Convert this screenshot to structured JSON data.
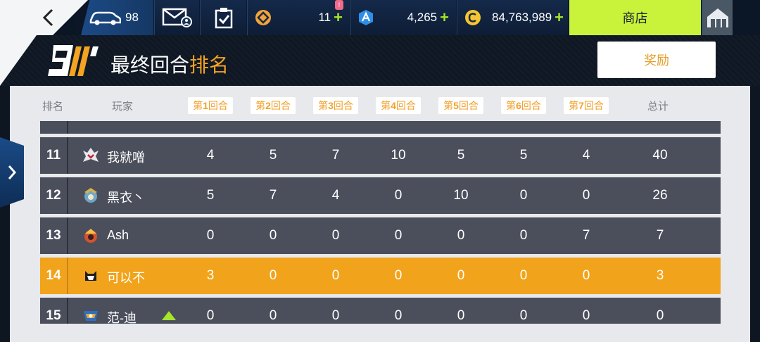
{
  "topbar": {
    "car_count": "98",
    "coin_diamond_value": "11",
    "coin_diamond_plus": "+",
    "coin_blue_value": "4,265",
    "coin_blue_plus": "+",
    "coin_gold_value": "84,763,989",
    "coin_gold_plus": "+",
    "notification_badge": "!",
    "shop_label": "商店"
  },
  "title": {
    "prefix": "最终回合",
    "accent": "排名",
    "logo_text": "9//'",
    "reward_label": "奖励"
  },
  "table": {
    "headers": {
      "rank": "排名",
      "player": "玩家",
      "rounds": [
        {
          "pre": "第",
          "num": "1",
          "post": "回合"
        },
        {
          "pre": "第",
          "num": "2",
          "post": "回合"
        },
        {
          "pre": "第",
          "num": "3",
          "post": "回合"
        },
        {
          "pre": "第",
          "num": "4",
          "post": "回合"
        },
        {
          "pre": "第",
          "num": "5",
          "post": "回合"
        },
        {
          "pre": "第",
          "num": "6",
          "post": "回合"
        },
        {
          "pre": "第",
          "num": "7",
          "post": "回合"
        }
      ],
      "total": "总计"
    },
    "rows": [
      {
        "rank": "11",
        "name": "我就噌",
        "scores": [
          "4",
          "5",
          "7",
          "10",
          "5",
          "5",
          "4"
        ],
        "total": "40",
        "highlight": false,
        "trend": ""
      },
      {
        "rank": "12",
        "name": "黑衣丶",
        "scores": [
          "5",
          "7",
          "4",
          "0",
          "10",
          "0",
          "0"
        ],
        "total": "26",
        "highlight": false,
        "trend": ""
      },
      {
        "rank": "13",
        "name": "Ash",
        "scores": [
          "0",
          "0",
          "0",
          "0",
          "0",
          "0",
          "7"
        ],
        "total": "7",
        "highlight": false,
        "trend": ""
      },
      {
        "rank": "14",
        "name": "可以不",
        "scores": [
          "3",
          "0",
          "0",
          "0",
          "0",
          "0",
          "0"
        ],
        "total": "3",
        "highlight": true,
        "trend": ""
      },
      {
        "rank": "15",
        "name": "范-迪",
        "scores": [
          "0",
          "0",
          "0",
          "0",
          "0",
          "0",
          "0"
        ],
        "total": "0",
        "highlight": false,
        "trend": "up"
      }
    ]
  },
  "colors": {
    "accent_orange": "#f1a31c",
    "lime": "#c9f23a",
    "row_dark": "#4b4f5c"
  }
}
